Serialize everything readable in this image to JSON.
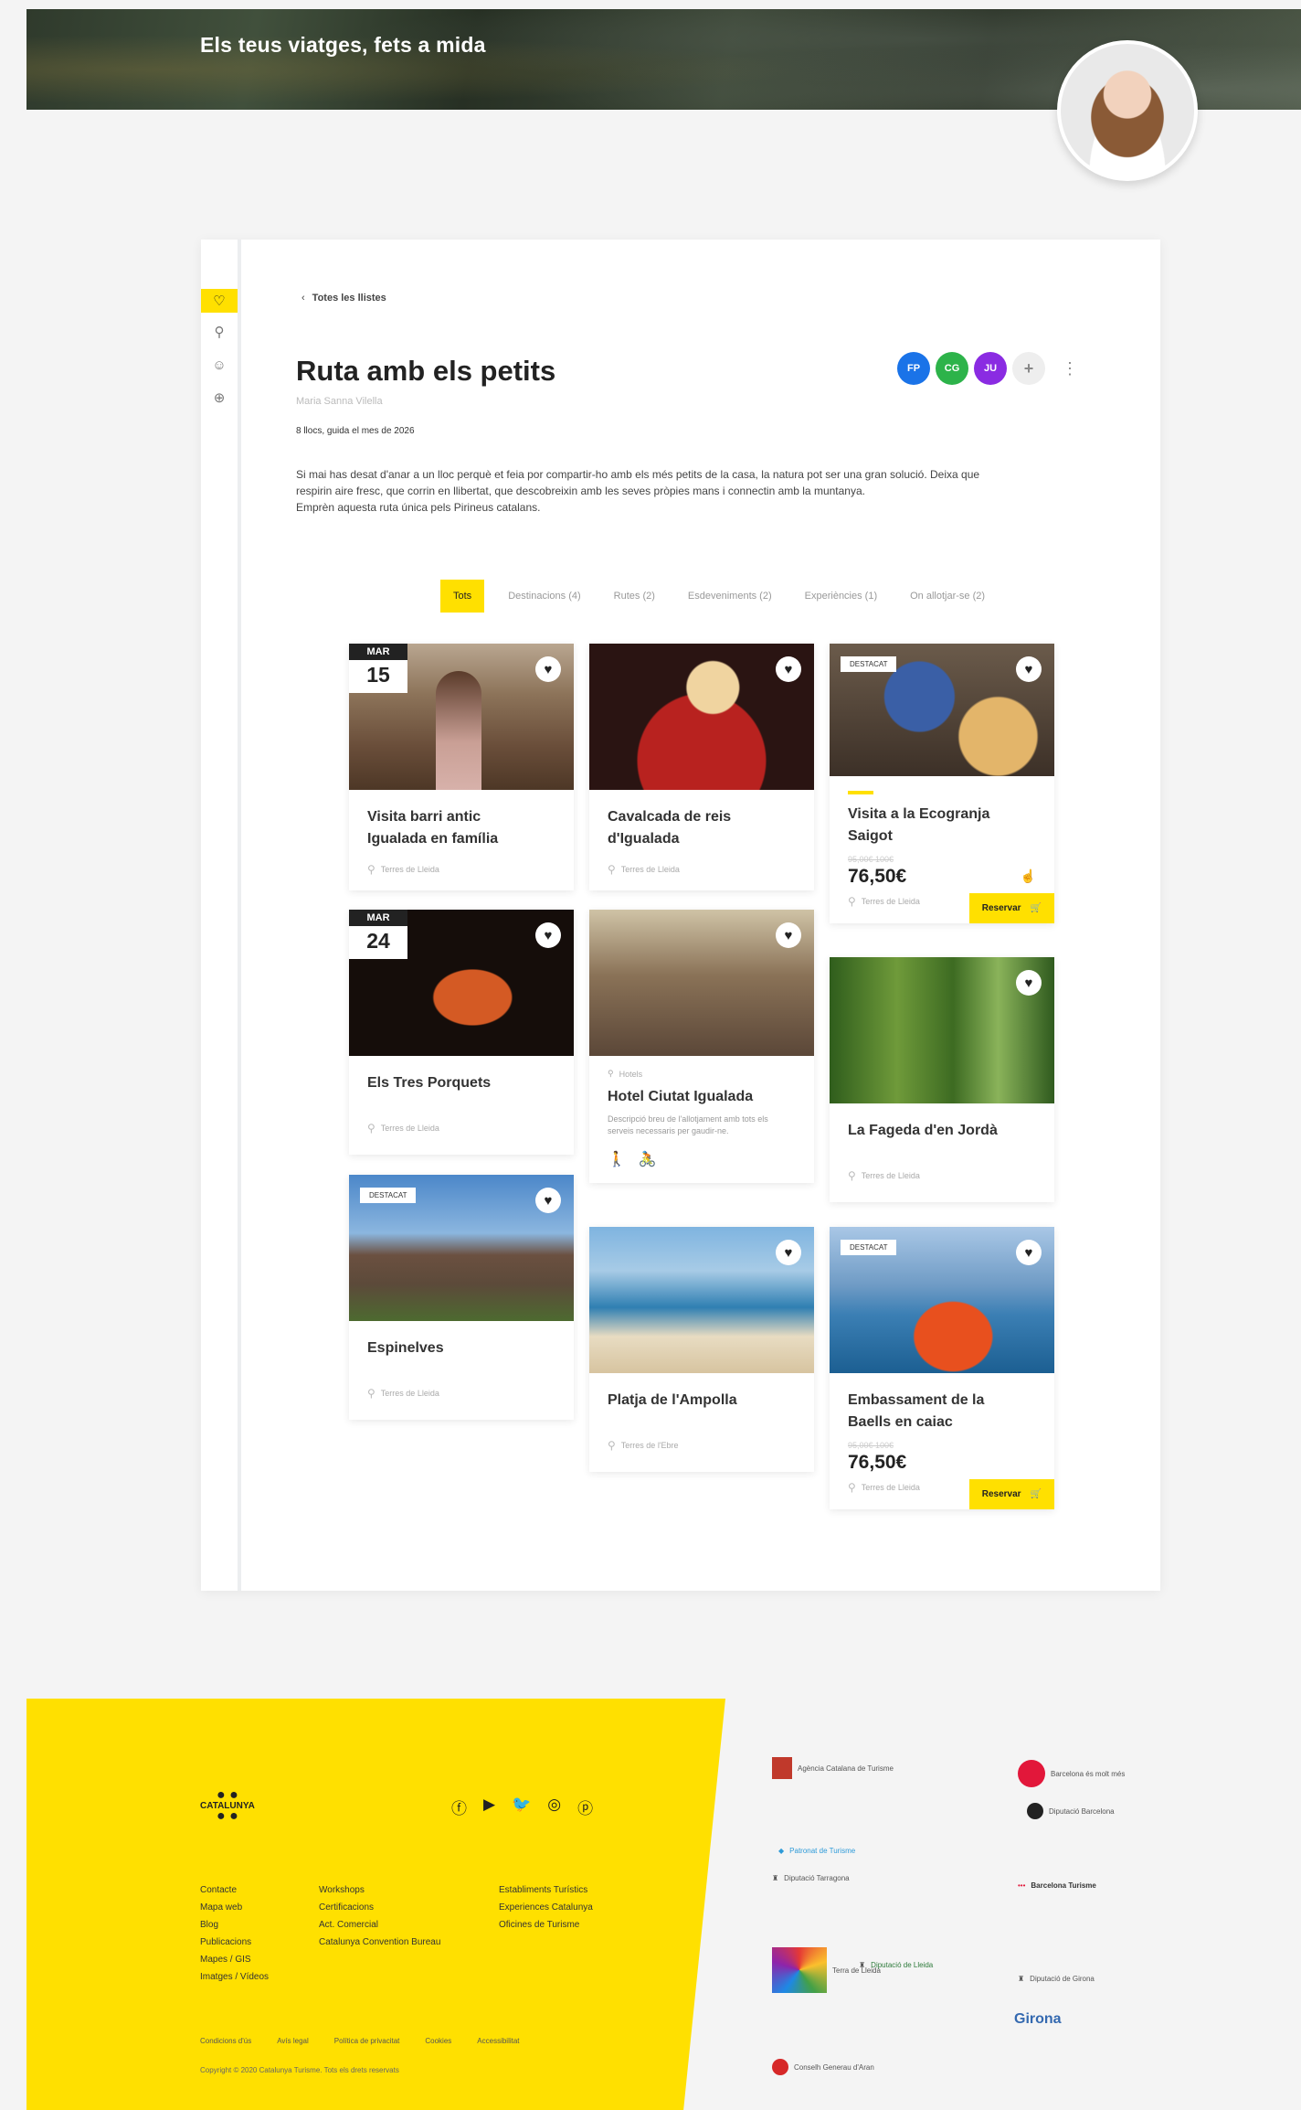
{
  "hero": {
    "subtitle": "Els teus viatges, fets a mida"
  },
  "sidebar": {
    "icons": [
      "heart-icon",
      "pin-icon",
      "user-icon",
      "globe-icon"
    ]
  },
  "route": {
    "back_label": "Totes les llistes",
    "title": "Ruta amb els petits",
    "author": "Maria Sanna Vilella",
    "meta": "8 llocs, guida el mes de 2026",
    "description_lines": [
      "Si mai has desat d'anar a un lloc perquè et feia por compartir-ho amb els més petits de la casa, la natura pot ser una gran solució. Deixa que",
      "respirin aire fresc, que corrin en llibertat, que descobreixin amb les seves pròpies mans i connectin amb la muntanya.",
      "Emprèn aquesta ruta única pels Pirineus catalans."
    ],
    "collaborators": [
      {
        "initials": "FP",
        "color": "#1a73e8"
      },
      {
        "initials": "CG",
        "color": "#2db34a"
      },
      {
        "initials": "JU",
        "color": "#8a2be2"
      }
    ],
    "add_label": "+",
    "more_label": "⋮"
  },
  "tabs": [
    "Tots",
    "Destinacions (4)",
    "Rutes (2)",
    "Esdeveniments (2)",
    "Experiències (1)",
    "On allotjar-se (2)"
  ],
  "cards": [
    {
      "name_lines": [
        "Visita barri antic",
        "Igualada en família"
      ],
      "loc": "Terres de Lleida",
      "month": "MAR",
      "day": "15"
    },
    {
      "name_lines": [
        "Cavalcada de reis",
        "d'Igualada"
      ],
      "loc": "Terres de Lleida"
    },
    {
      "tag": "DESTACAT",
      "name_lines": [
        "Visita a la Ecogranja",
        "Saigot"
      ],
      "old_price": "95,00€  100€",
      "price": "76,50€",
      "loc": "Terres de Lleida",
      "reserve": "Reservar"
    },
    {
      "name_lines": [
        "Els Tres Porquets"
      ],
      "loc": "Terres de Lleida",
      "month": "MAR",
      "day": "24"
    },
    {
      "category": "Hotels",
      "name_lines": [
        "Hotel Ciutat Igualada"
      ],
      "small": "Descripció breu de l'allotjament amb tots els serveis necessaris per gaudir-ne.",
      "icons": [
        "walk-icon",
        "bike-icon"
      ]
    },
    {
      "name_lines": [
        "La Fageda d'en Jordà"
      ],
      "loc": "Terres de Lleida"
    },
    {
      "tag": "DESTACAT",
      "name_lines": [
        "Espinelves"
      ],
      "loc": "Terres de Lleida"
    },
    {
      "name_lines": [
        "Platja de l'Ampolla"
      ],
      "loc": "Terres de l'Ebre"
    },
    {
      "tag": "DESTACAT",
      "name_lines": [
        "Embassament de la",
        "Baells en caiac"
      ],
      "old_price": "95,00€  100€",
      "price": "76,50€",
      "loc": "Terres de Lleida",
      "reserve": "Reservar"
    }
  ],
  "footer": {
    "logo": "CATALUNYA",
    "social": [
      "facebook-icon",
      "youtube-icon",
      "twitter-icon",
      "instagram-icon",
      "pinterest-icon"
    ],
    "col1": [
      "Contacte",
      "Mapa web",
      "Blog",
      "Publicacions",
      "Mapes / GIS",
      "Imatges / Vídeos"
    ],
    "col2": [
      "Workshops",
      "Certificacions",
      "Act. Comercial",
      "Catalunya Convention Bureau"
    ],
    "col3": [
      "Establiments Turístics",
      "Experiences Catalunya",
      "Oficines de Turisme"
    ],
    "legal": [
      "Condicions d'ús",
      "Avís legal",
      "Política de privacitat",
      "Cookies",
      "Accessibilitat"
    ],
    "copyright": "Copyright © 2020 Catalunya Turisme. Tots els drets reservats",
    "partners": [
      "Agència Catalana de Turisme",
      "Barcelona és molt més",
      "Diputació Barcelona",
      "Patronat de Turisme",
      "Diputació Tarragona",
      "Barcelona Turisme",
      "Terra de Lleida",
      "Diputació de Lleida",
      "Diputació de Girona",
      "Girona",
      "Conselh Generau d'Aran"
    ]
  }
}
